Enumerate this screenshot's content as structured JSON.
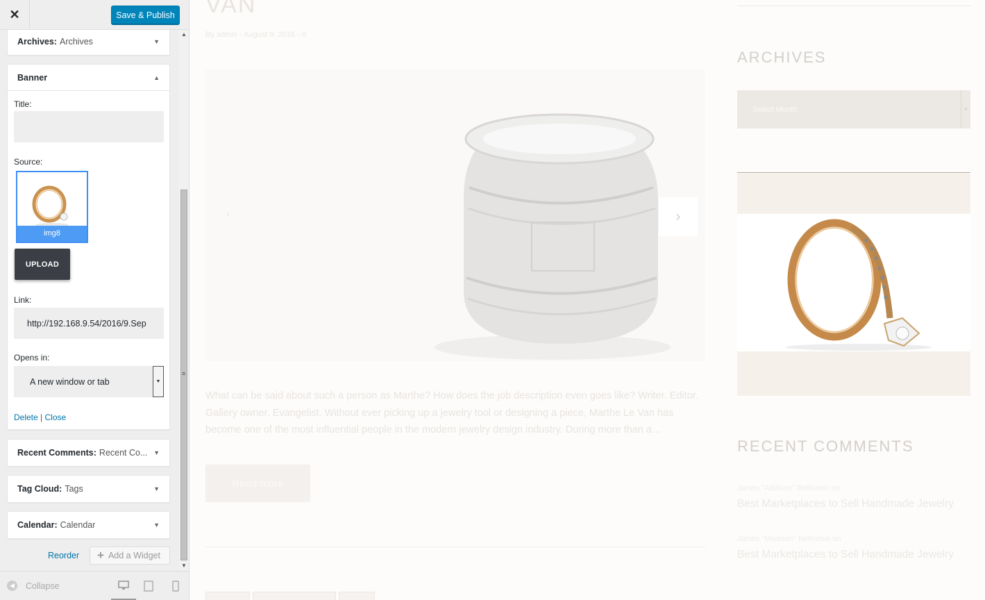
{
  "customizer": {
    "close_icon": "close-icon",
    "publish_label": "Save & Publish",
    "widgets": {
      "archives": {
        "name": "Archives:",
        "title": "Archives"
      },
      "banner": {
        "name": "Banner",
        "title_label": "Title:",
        "title_value": "",
        "source_label": "Source:",
        "image_caption": "img8",
        "upload_label": "UPLOAD",
        "link_label": "Link:",
        "link_value": "http://192.168.9.54/2016/9.Sep",
        "opens_label": "Opens in:",
        "opens_value": "A new window or tab",
        "delete_label": "Delete",
        "separator": "|",
        "close_label": "Close"
      },
      "recent_comments": {
        "name": "Recent Comments:",
        "title": "Recent Co..."
      },
      "tag_cloud": {
        "name": "Tag Cloud:",
        "title": "Tags"
      },
      "calendar": {
        "name": "Calendar:",
        "title": "Calendar"
      }
    },
    "reorder_label": "Reorder",
    "add_widget_label": "Add a Widget",
    "collapse_label": "Collapse",
    "devices": [
      "desktop",
      "tablet",
      "mobile"
    ]
  },
  "preview": {
    "post_title": "VAN",
    "post_meta": "By admin - August 9, 2016 - 0",
    "excerpt": "What can be said about such a person as Marthe? How does the job description even goes like? Writer. Editor. Gallery owner. Evangelist. Without ever picking up a jewelry tool or designing a piece, Marthe Le Van has become one of the most influential people in the modern jewelry design industry. During more than a…",
    "read_more": "Read more",
    "sidebar": {
      "archives_heading": "ARCHIVES",
      "select_month": "Select Month",
      "recent_comments_heading": "RECENT COMMENTS",
      "comments": [
        {
          "author": "James \"Addison\" Bellovisio on",
          "link": "Best Marketplaces to Sell Handmade Jewelry"
        },
        {
          "author": "James \"Madison\" Bellovisio on",
          "link": "Best Marketplaces to Sell Handmade Jewelry"
        }
      ]
    }
  }
}
